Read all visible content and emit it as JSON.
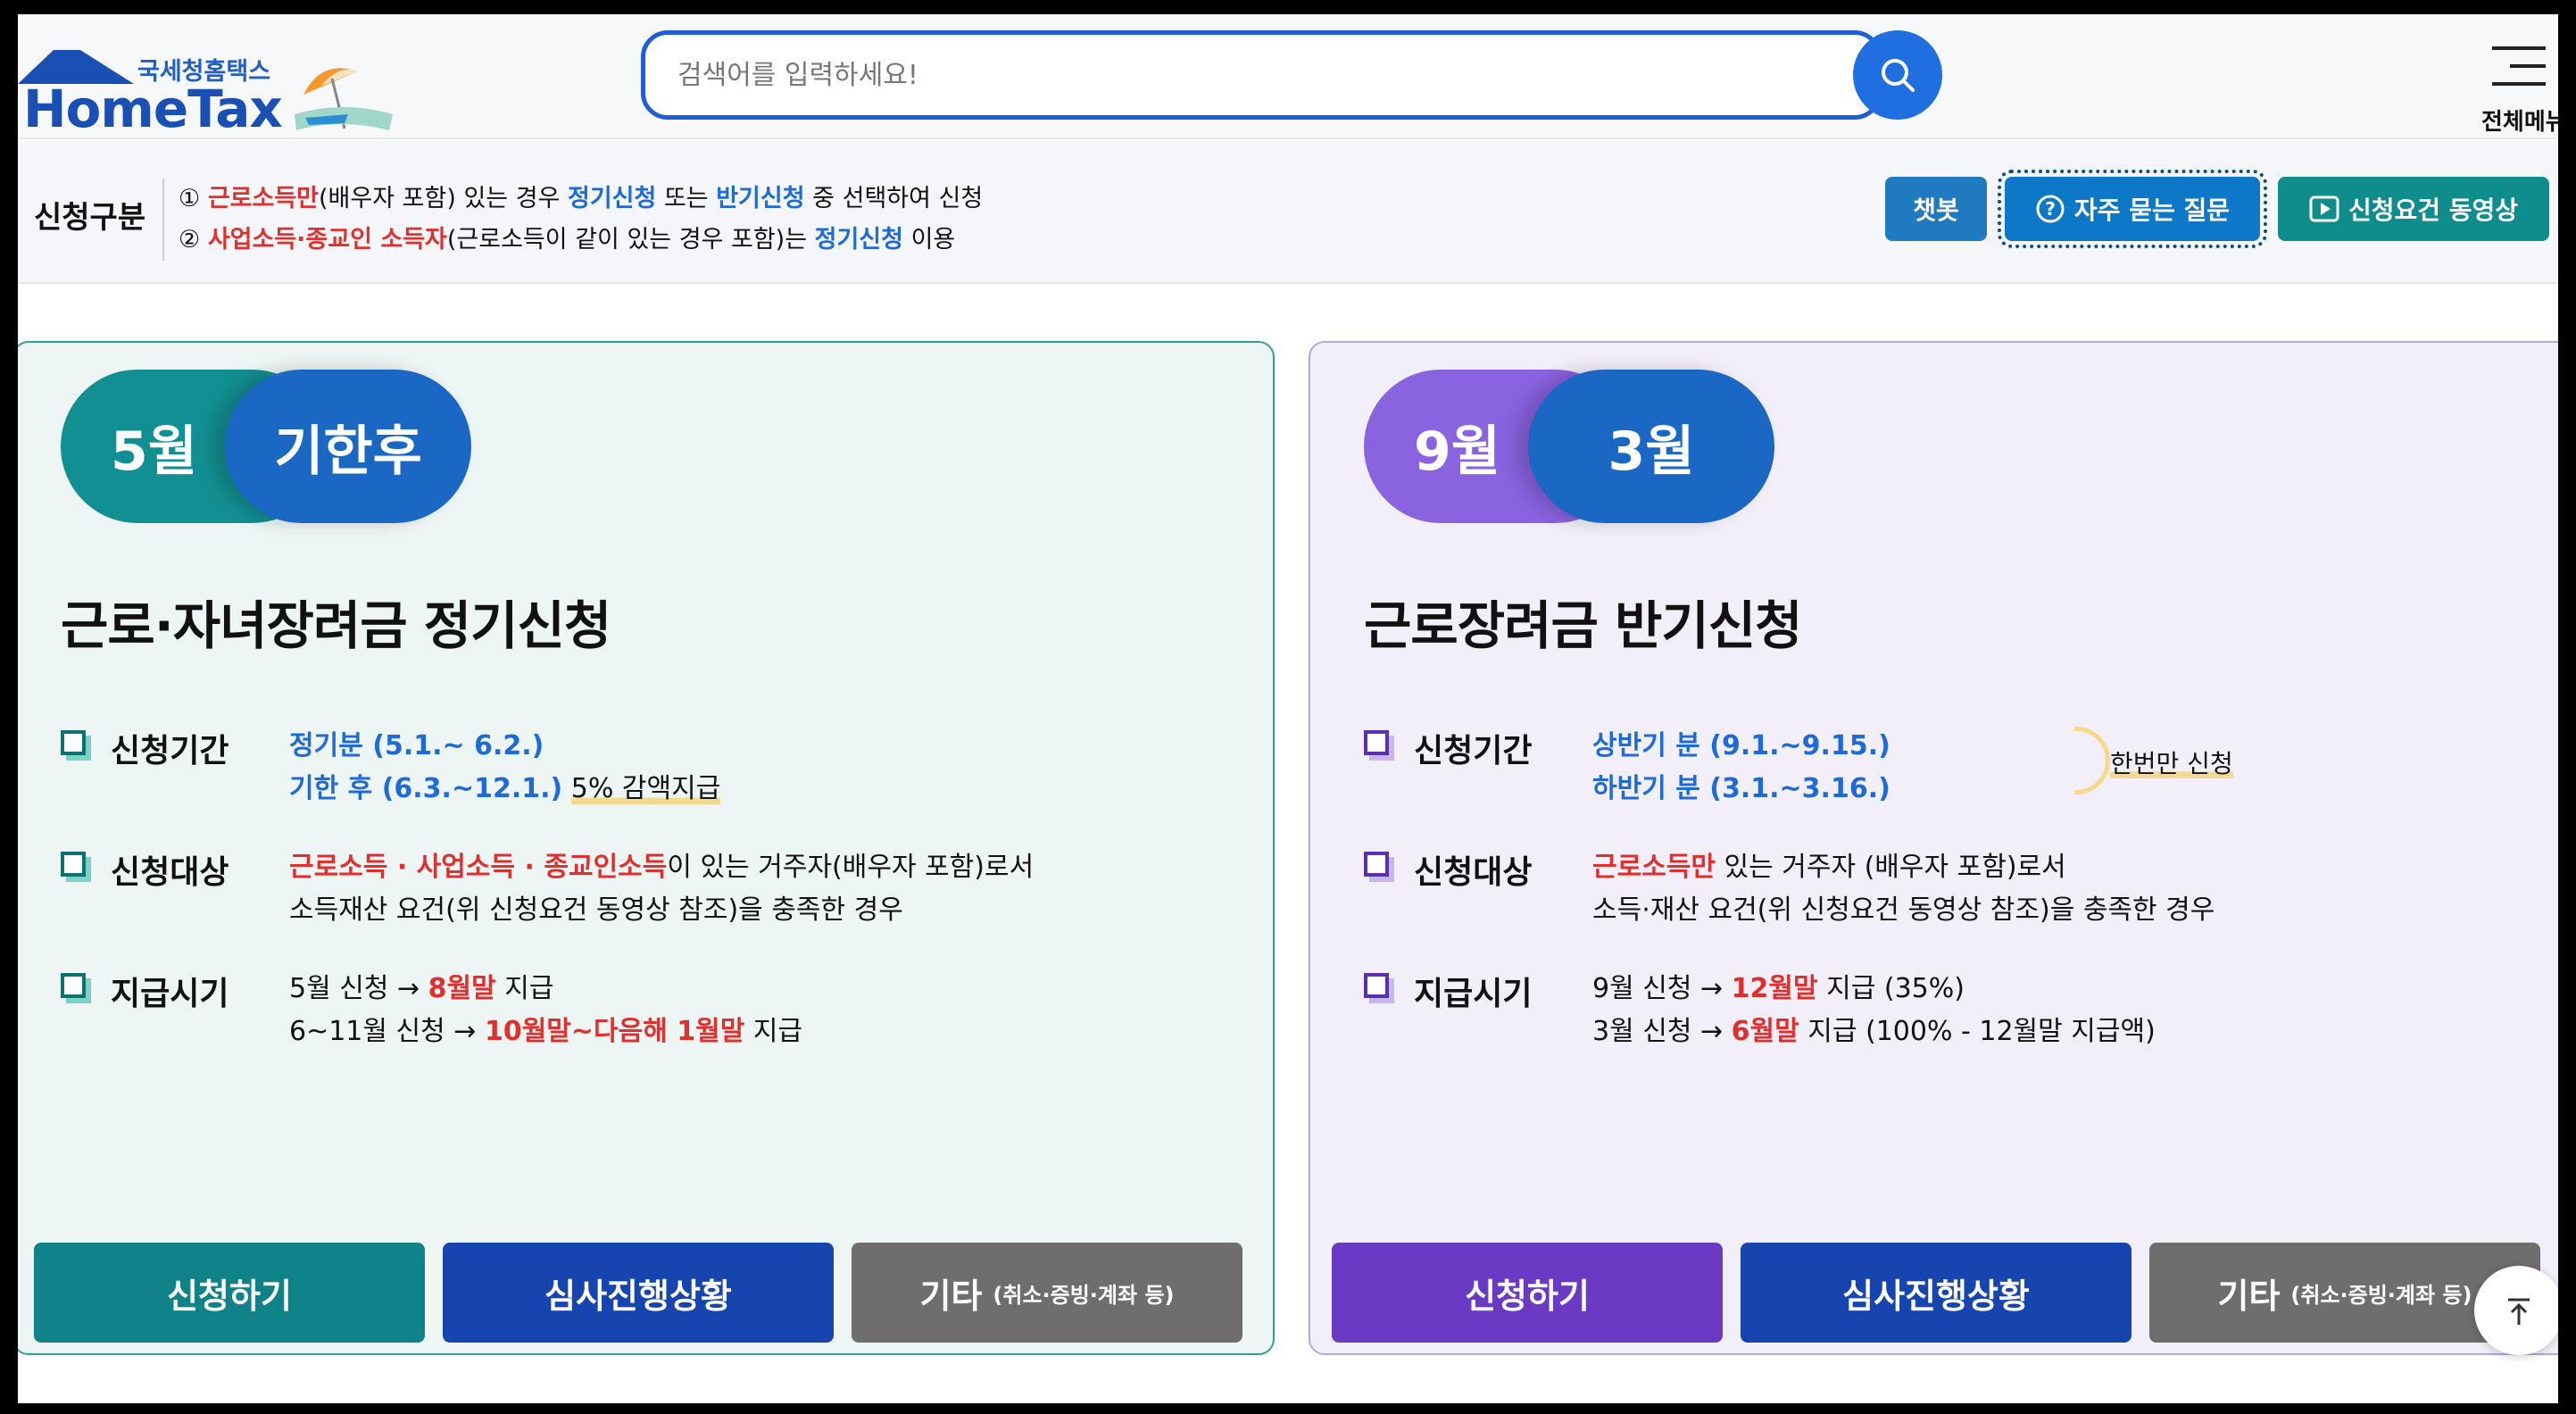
{
  "header": {
    "logo_small": "국세청홈택스",
    "logo_big": "HomeTax",
    "search_placeholder": "검색어를 입력하세요!",
    "menu_label": "전체메뉴"
  },
  "notice": {
    "label": "신청구분",
    "line1": {
      "num": "①",
      "red": "근로소득만",
      "t1": "(배우자 포함) 있는 경우 ",
      "blue1": "정기신청",
      "t2": " 또는 ",
      "blue2": "반기신청",
      "t3": " 중 선택하여 신청"
    },
    "line2": {
      "num": "②",
      "red": "사업소득·종교인 소득자",
      "t1": "(근로소득이 같이 있는 경우 포함)는 ",
      "blue1": "정기신청",
      "t2": " 이용"
    },
    "buttons": {
      "chatbot": "챗봇",
      "faq": "자주 묻는 질문",
      "video": "신청요건 동영상"
    }
  },
  "cards": [
    {
      "pill_a": "5월",
      "pill_b": "기한후",
      "title": "근로·자녀장려금 정기신청",
      "period_head": "신청기간",
      "period_1": "정기분 (5.1.~ 6.2.)",
      "period_2": "기한 후 (6.3.~12.1.)",
      "period_note": "5% 감액지급",
      "target_head": "신청대상",
      "target_red": "근로소득 · 사업소득 · 종교인소득",
      "target_1": "이 있는 거주자(배우자 포함)로서",
      "target_2": "소득재산 요건(위 신청요건 동영상 참조)을 충족한 경우",
      "pay_head": "지급시기",
      "pay_1a": "5월 신청 → ",
      "pay_1red": "8월말",
      "pay_1b": " 지급",
      "pay_2a": "6~11월 신청 → ",
      "pay_2red": "10월말~다음해 1월말",
      "pay_2b": " 지급",
      "btn_apply": "신청하기",
      "btn_status": "심사진행상황",
      "btn_etc": "기타",
      "btn_etc_small": "(취소·증빙·계좌 등)"
    },
    {
      "pill_a": "9월",
      "pill_b": "3월",
      "title": "근로장려금 반기신청",
      "period_head": "신청기간",
      "period_1": "상반기 분 (9.1.~9.15.)",
      "period_2": "하반기 분 (3.1.~3.16.)",
      "period_note": "한번만 신청",
      "target_head": "신청대상",
      "target_red": "근로소득만",
      "target_1": " 있는 거주자 (배우자 포함)로서",
      "target_2": "소득·재산 요건(위 신청요건 동영상 참조)을 충족한 경우",
      "pay_head": "지급시기",
      "pay_1a": "9월 신청 → ",
      "pay_1red": "12월말",
      "pay_1b": " 지급 (35%)",
      "pay_2a": "3월 신청 → ",
      "pay_2red": "6월말",
      "pay_2b": " 지급 (100% - 12월말 지급액)",
      "btn_apply": "신청하기",
      "btn_status": "심사진행상황",
      "btn_etc": "기타",
      "btn_etc_small": "(취소·증빙·계좌 등)"
    }
  ],
  "colors": {
    "teal": "#128f92",
    "purple": "#8a63e0",
    "blue": "#1a67c4",
    "red": "#e0302e"
  }
}
